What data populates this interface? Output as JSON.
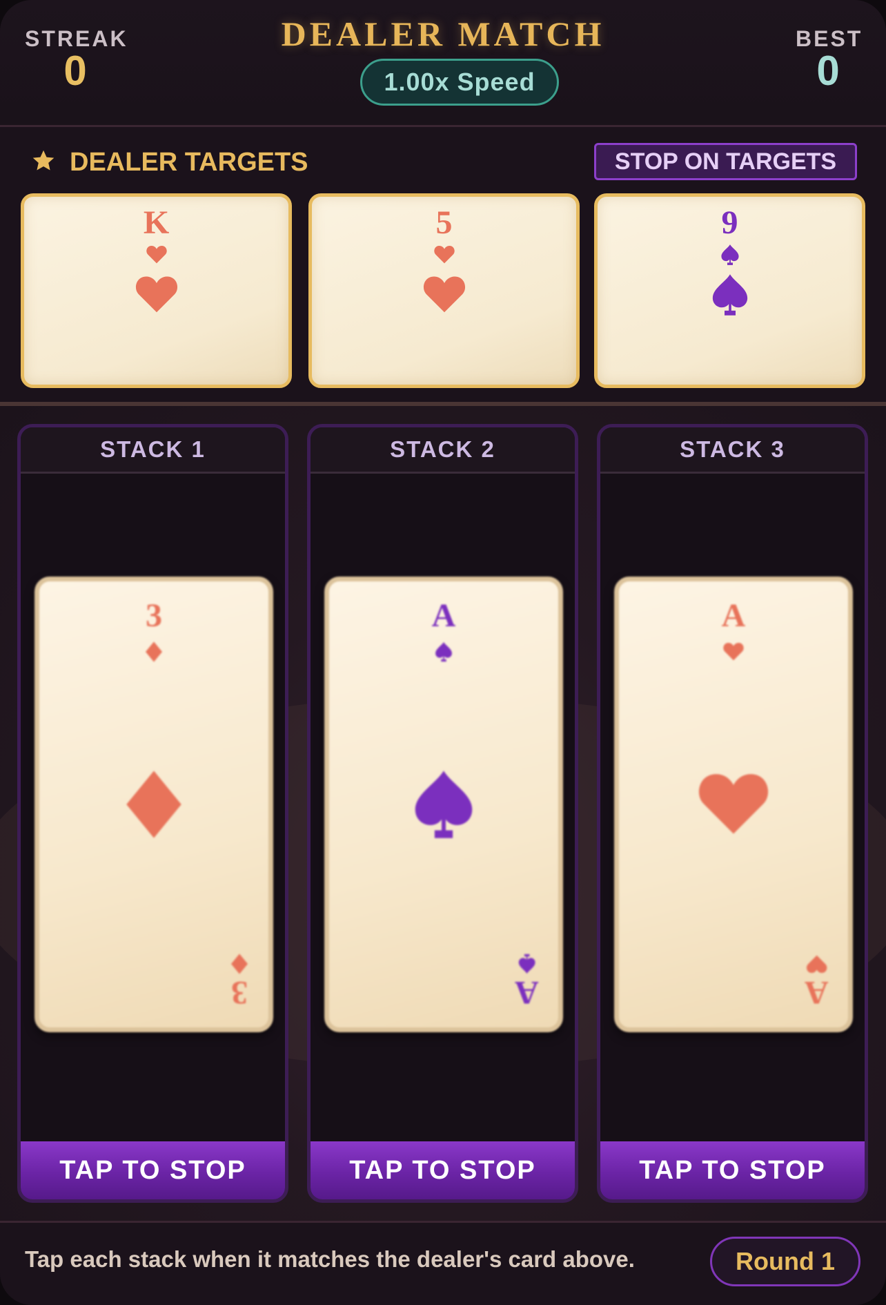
{
  "header": {
    "streak_label": "STREAK",
    "streak_value": "0",
    "title": "DEALER MATCH",
    "speed": "1.00x Speed",
    "best_label": "BEST",
    "best_value": "0"
  },
  "targets": {
    "title": "DEALER TARGETS",
    "stop_button": "STOP ON TARGETS",
    "cards": [
      {
        "rank": "K",
        "suit": "hearts",
        "color": "#e8735a"
      },
      {
        "rank": "5",
        "suit": "hearts",
        "color": "#e8735a"
      },
      {
        "rank": "9",
        "suit": "spades",
        "color": "#7b2fbe"
      }
    ]
  },
  "stacks": [
    {
      "label": "STACK 1",
      "card": {
        "rank": "3",
        "suit": "diamonds",
        "color": "#e8735a"
      },
      "button": "TAP TO STOP"
    },
    {
      "label": "STACK 2",
      "card": {
        "rank": "A",
        "suit": "spades",
        "color": "#7b2fbe"
      },
      "button": "TAP TO STOP"
    },
    {
      "label": "STACK 3",
      "card": {
        "rank": "A",
        "suit": "hearts",
        "color": "#e8735a"
      },
      "button": "TAP TO STOP"
    }
  ],
  "footer": {
    "hint": "Tap each stack when it matches the dealer's card above.",
    "round": "Round 1"
  },
  "colors": {
    "gold": "#e7bb5f",
    "purple": "#7b2fbe",
    "coral": "#e8735a",
    "teal": "#3c9f8c"
  }
}
